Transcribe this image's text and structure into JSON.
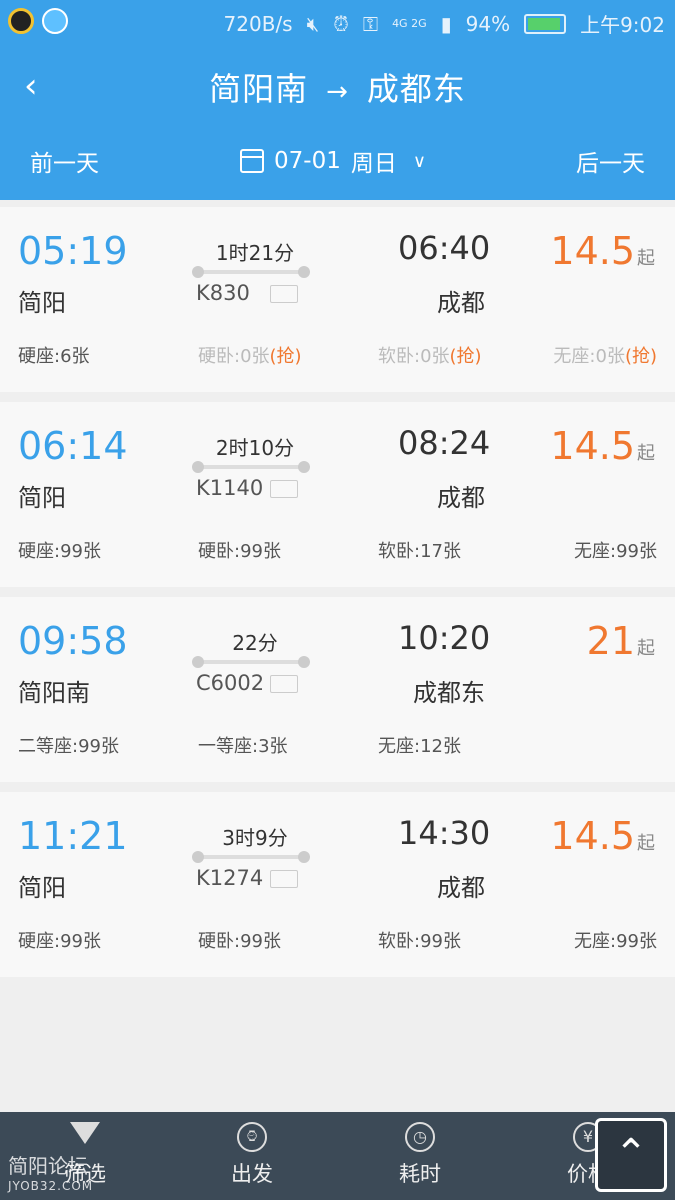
{
  "status_bar": {
    "net_speed": "720B/s",
    "signal_tags": "4G 2G",
    "battery": "94%",
    "battery_level": 0.94,
    "time": "上午9:02"
  },
  "header": {
    "from": "简阳南",
    "to": "成都东",
    "arrow": "→",
    "prev_day": "前一天",
    "date": "07-01",
    "weekday": "周日",
    "next_day": "后一天"
  },
  "trains": [
    {
      "dep_time": "05:19",
      "dep_station": "简阳",
      "duration": "1时21分",
      "train_no": "K830",
      "arr_time": "06:40",
      "arr_station": "成都",
      "price": "14.5",
      "price_suffix": "起",
      "seats": [
        {
          "label": "硬座:6张",
          "dim": false,
          "grab": ""
        },
        {
          "label": "硬卧:0张",
          "dim": true,
          "grab": "(抢)"
        },
        {
          "label": "软卧:0张",
          "dim": true,
          "grab": "(抢)"
        },
        {
          "label": "无座:0张",
          "dim": true,
          "grab": "(抢)"
        }
      ]
    },
    {
      "dep_time": "06:14",
      "dep_station": "简阳",
      "duration": "2时10分",
      "train_no": "K1140",
      "arr_time": "08:24",
      "arr_station": "成都",
      "price": "14.5",
      "price_suffix": "起",
      "seats": [
        {
          "label": "硬座:99张",
          "dim": false,
          "grab": ""
        },
        {
          "label": "硬卧:99张",
          "dim": false,
          "grab": ""
        },
        {
          "label": "软卧:17张",
          "dim": false,
          "grab": ""
        },
        {
          "label": "无座:99张",
          "dim": false,
          "grab": ""
        }
      ]
    },
    {
      "dep_time": "09:58",
      "dep_station": "简阳南",
      "duration": "22分",
      "train_no": "C6002",
      "arr_time": "10:20",
      "arr_station": "成都东",
      "price": "21",
      "price_suffix": "起",
      "seats": [
        {
          "label": "二等座:99张",
          "dim": false,
          "grab": ""
        },
        {
          "label": "一等座:3张",
          "dim": false,
          "grab": ""
        },
        {
          "label": "无座:12张",
          "dim": false,
          "grab": ""
        }
      ]
    },
    {
      "dep_time": "11:21",
      "dep_station": "简阳",
      "duration": "3时9分",
      "train_no": "K1274",
      "arr_time": "14:30",
      "arr_station": "成都",
      "price": "14.5",
      "price_suffix": "起",
      "seats": [
        {
          "label": "硬座:99张",
          "dim": false,
          "grab": ""
        },
        {
          "label": "硬卧:99张",
          "dim": false,
          "grab": ""
        },
        {
          "label": "软卧:99张",
          "dim": false,
          "grab": ""
        },
        {
          "label": "无座:99张",
          "dim": false,
          "grab": ""
        }
      ]
    }
  ],
  "bottom_tabs": [
    {
      "label": "筛选",
      "icon": "filter-icon"
    },
    {
      "label": "出发",
      "icon": "clock-icon"
    },
    {
      "label": "耗时",
      "icon": "timer-icon"
    },
    {
      "label": "价格",
      "icon": "yuan-icon",
      "glyph": "¥"
    }
  ],
  "back_to_top": "⌃",
  "watermark": {
    "line1": "简阳论坛",
    "line2": "JYOB32.COM"
  }
}
